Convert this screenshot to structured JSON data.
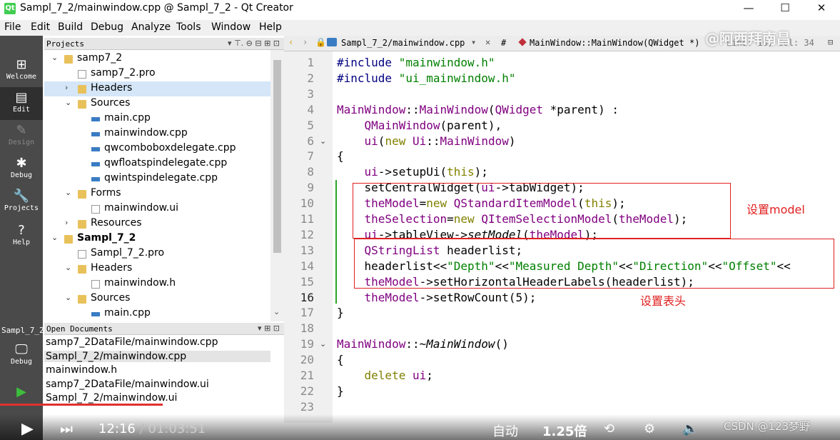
{
  "window": {
    "title": "Sampl_7_2/mainwindow.cpp @ Sampl_7_2 - Qt Creator",
    "icon_text": "Qt",
    "minimize": "—",
    "maximize": "☐",
    "close": "✕"
  },
  "menu": [
    "File",
    "Edit",
    "Build",
    "Debug",
    "Analyze",
    "Tools",
    "Window",
    "Help"
  ],
  "modes": [
    {
      "label": "Welcome",
      "glyph": "⊞"
    },
    {
      "label": "Edit",
      "glyph": "▤"
    },
    {
      "label": "Design",
      "glyph": "✎"
    },
    {
      "label": "Debug",
      "glyph": "✱"
    },
    {
      "label": "Projects",
      "glyph": "🔧"
    },
    {
      "label": "Help",
      "glyph": "?"
    }
  ],
  "run_panel": {
    "kit": "Sampl_7_2",
    "mode": "Debug"
  },
  "projects_panel": {
    "title": "Projects",
    "tree": [
      {
        "label": "samp7_2",
        "icon": "folder",
        "expanded": true
      },
      {
        "label": "samp7_2.pro",
        "icon": "pro"
      },
      {
        "label": "Headers",
        "icon": "folder",
        "expanded": false,
        "selected": true
      },
      {
        "label": "Sources",
        "icon": "folder",
        "expanded": true
      },
      {
        "label": "main.cpp",
        "icon": "cpp"
      },
      {
        "label": "mainwindow.cpp",
        "icon": "cpp"
      },
      {
        "label": "qwcomboboxdelegate.cpp",
        "icon": "cpp"
      },
      {
        "label": "qwfloatspindelegate.cpp",
        "icon": "cpp"
      },
      {
        "label": "qwintspindelegate.cpp",
        "icon": "cpp"
      },
      {
        "label": "Forms",
        "icon": "folder",
        "expanded": true
      },
      {
        "label": "mainwindow.ui",
        "icon": "ui"
      },
      {
        "label": "Resources",
        "icon": "folder",
        "expanded": false
      },
      {
        "label": "Sampl_7_2",
        "icon": "folder",
        "expanded": true,
        "bold": true
      },
      {
        "label": "Sampl_7_2.pro",
        "icon": "pro"
      },
      {
        "label": "Headers",
        "icon": "folder",
        "expanded": true
      },
      {
        "label": "mainwindow.h",
        "icon": "h"
      },
      {
        "label": "Sources",
        "icon": "folder",
        "expanded": true
      },
      {
        "label": "main.cpp",
        "icon": "cpp"
      }
    ]
  },
  "open_documents": {
    "title": "Open Documents",
    "items": [
      "samp7_2DataFile/mainwindow.cpp",
      "Sampl_7_2/mainwindow.cpp",
      "mainwindow.h",
      "samp7_2DataFile/mainwindow.ui",
      "Sampl_7_2/mainwindow.ui"
    ],
    "selected_index": 1
  },
  "editor_toolbar": {
    "file": "Sampl_7_2/mainwindow.cpp",
    "hash": "#",
    "symbol": "MainWindow::MainWindow(QWidget *)",
    "line_col": "Line: 16, Col: 34"
  },
  "code": {
    "current_line": 16,
    "lines": [
      "#include \"mainwindow.h\"",
      "#include \"ui_mainwindow.h\"",
      "",
      "MainWindow::MainWindow(QWidget *parent) :",
      "    QMainWindow(parent),",
      "    ui(new Ui::MainWindow)",
      "{",
      "    ui->setupUi(this);",
      "    setCentralWidget(ui->tabWidget);",
      "    theModel=new QStandardItemModel(this);",
      "    theSelection=new QItemSelectionModel(theModel);",
      "    ui->tableView->setModel(theModel);",
      "    QStringList headerlist;",
      "    headerlist<<\"Depth\"<<\"Measured Depth\"<<\"Direction\"<<\"Offset\"<<",
      "    theModel->setHorizontalHeaderLabels(headerlist);",
      "    theModel->setRowCount(5);",
      "}",
      "",
      "MainWindow::~MainWindow()",
      "{",
      "    delete ui;",
      "}",
      ""
    ]
  },
  "annotations": {
    "model": "设置model",
    "header": "设置表头"
  },
  "video": {
    "time_current": "12:16",
    "time_sep": " / ",
    "time_total": "01:03:51",
    "auto": "自动",
    "speed": "1.25倍",
    "progress": 0.194
  },
  "watermark": "@阿西拜南昌",
  "csdn": "CSDN @123梦野",
  "colors": {
    "keyword": "#808000",
    "string": "#008000",
    "type": "#800080",
    "function": "#00677c",
    "annotation": "#e02020",
    "mode_bar": "#4a4a4a"
  }
}
